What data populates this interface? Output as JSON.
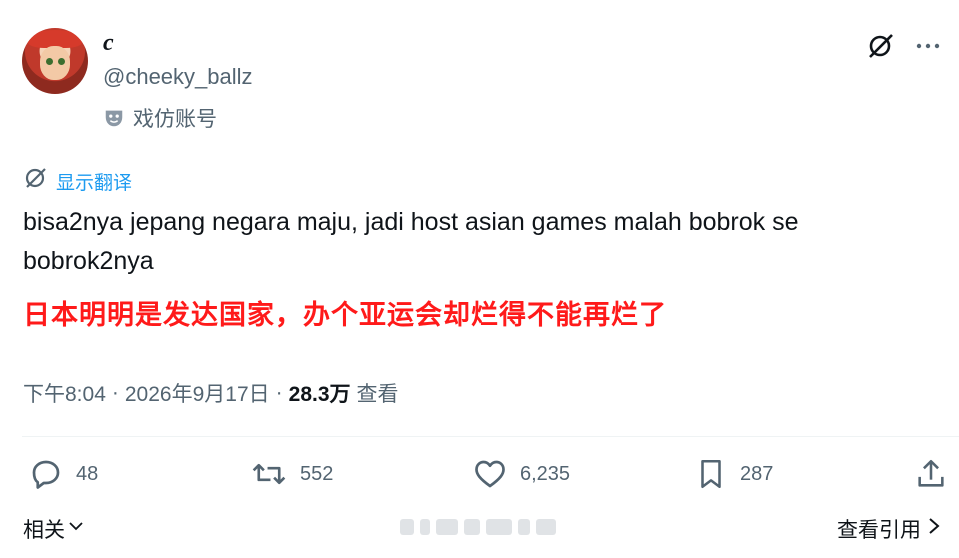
{
  "user": {
    "display_name": "c",
    "handle": "@cheeky_ballz",
    "parody_label": "戏仿账号"
  },
  "translate": {
    "label": "显示翻译"
  },
  "tweet": {
    "text": "bisa2nya jepang negara maju, jadi host asian games malah bobrok se bobrok2nya",
    "translation": "日本明明是发达国家，办个亚运会却烂得不能再烂了"
  },
  "meta": {
    "time": "下午8:04",
    "separator": "·",
    "date": "2026年9月17日",
    "views_count": "28.3万",
    "views_label": "查看"
  },
  "actions": {
    "replies": "48",
    "retweets": "552",
    "likes": "6,235",
    "bookmarks": "287"
  },
  "footer": {
    "related_label": "相关",
    "quotes_label": "查看引用"
  },
  "colors": {
    "accent": "#1d9bf0",
    "muted": "#536471",
    "translation_red": "#ff1a1a"
  },
  "icons": [
    "grok-icon",
    "more-icon",
    "mask-icon",
    "translate-icon",
    "reply-icon",
    "retweet-icon",
    "like-icon",
    "bookmark-icon",
    "share-icon",
    "chevron-down-icon",
    "chevron-right-icon"
  ]
}
